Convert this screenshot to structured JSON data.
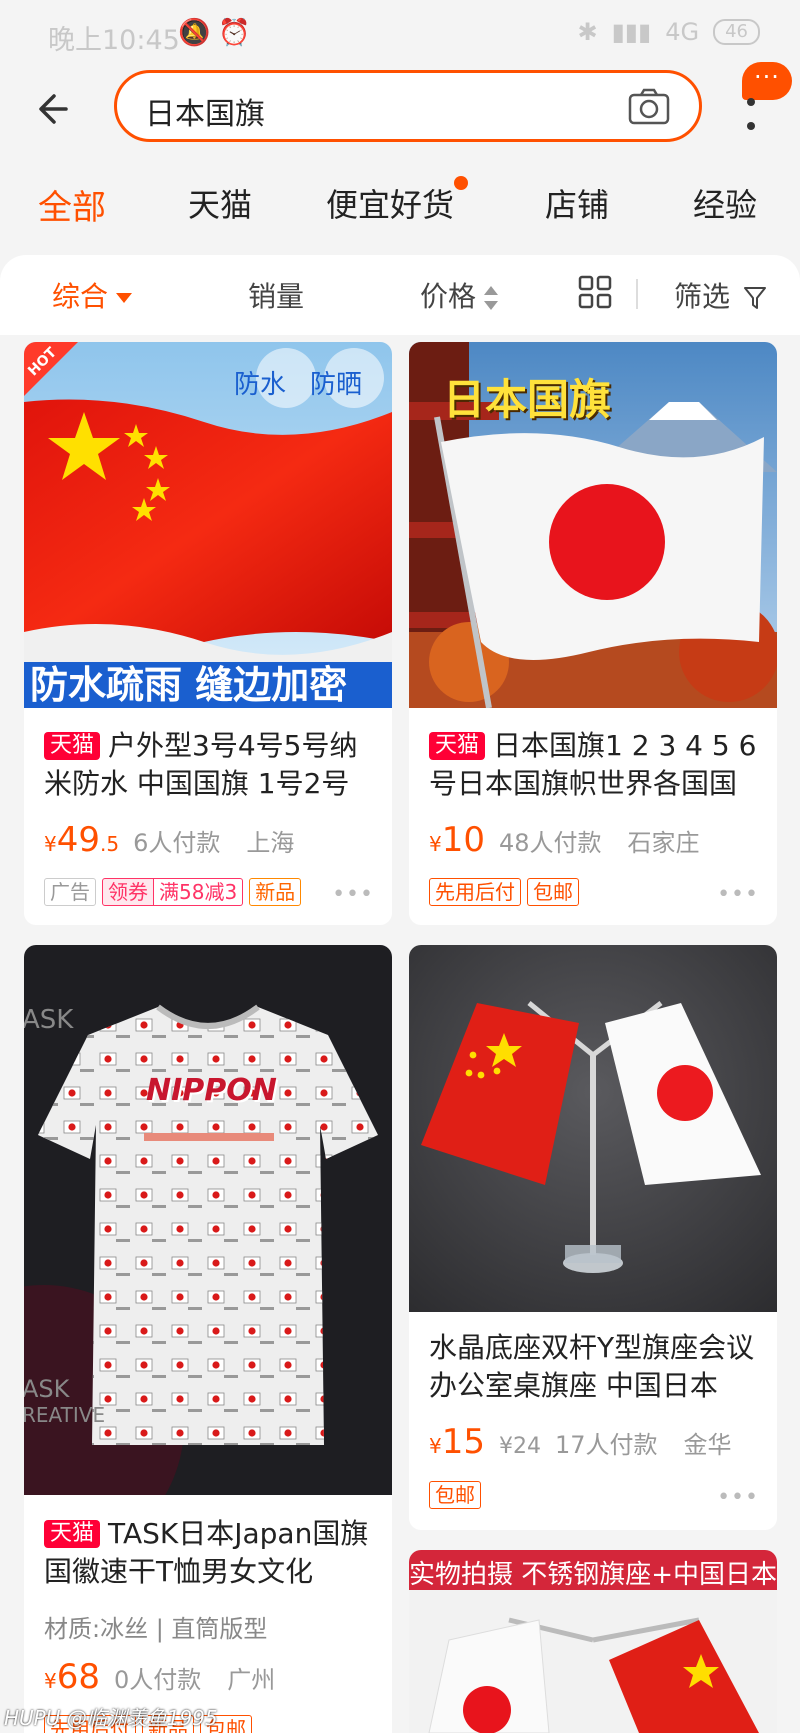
{
  "status_bar": {
    "time": "晚上10:45",
    "network": "4G",
    "battery": "46"
  },
  "search": {
    "query": "日本国旗"
  },
  "more_badge": "···",
  "tabs": [
    {
      "label": "全部",
      "active": true
    },
    {
      "label": "天猫"
    },
    {
      "label": "便宜好货",
      "dot": true
    },
    {
      "label": "店铺"
    },
    {
      "label": "经验"
    }
  ],
  "filters": {
    "comprehensive": "综合",
    "sales": "销量",
    "price": "价格",
    "screen": "筛选"
  },
  "products": [
    {
      "tmall": "天猫",
      "title": "户外型3号4号5号纳米防水 中国国旗 1号2号",
      "price_symbol": "¥",
      "price": "49",
      "price_decimal": ".5",
      "paid": "6人付款",
      "location": "上海",
      "tags": [
        "广告",
        "领券",
        "满58减3",
        "新品"
      ],
      "image_text": {
        "hot": "HOT",
        "bubble1": "防水",
        "bubble2": "防晒",
        "banner": "防水疏雨 缝边加密"
      }
    },
    {
      "tmall": "天猫",
      "title": "日本国旗1 2 3 4 5 6号日本国旗帜世界各国国",
      "price_symbol": "¥",
      "price": "10",
      "paid": "48人付款",
      "location": "石家庄",
      "tags": [
        "先用后付",
        "包邮"
      ],
      "image_text": {
        "headline": "日本国旗"
      }
    },
    {
      "tmall": "天猫",
      "title": "TASK日本Japan国旗国徽速干T恤男女文化",
      "attrs": "材质:冰丝 | 直筒版型",
      "price_symbol": "¥",
      "price": "68",
      "paid": "0人付款",
      "location": "广州",
      "tags": [
        "先用后付",
        "新品",
        "包邮"
      ],
      "image_text": {
        "brand": "NIPPON",
        "bg1": "ASK",
        "bg2": "ASK",
        "bg3": "REATIVE"
      }
    },
    {
      "title": "水晶底座双杆Y型旗座会议办公室桌旗座 中国日本",
      "price_symbol": "¥",
      "price": "15",
      "orig_price": "¥24",
      "paid": "17人付款",
      "location": "金华",
      "tags": [
        "包邮"
      ]
    },
    {
      "image_text": {
        "banner": "实物拍摄 不锈钢旗座+中国日本桌旗"
      }
    }
  ],
  "watermark": "HUPU @临渊羡鱼1995",
  "colors": {
    "accent": "#ff5000",
    "tmall": "#ff0036",
    "background": "#f4f4f4"
  }
}
